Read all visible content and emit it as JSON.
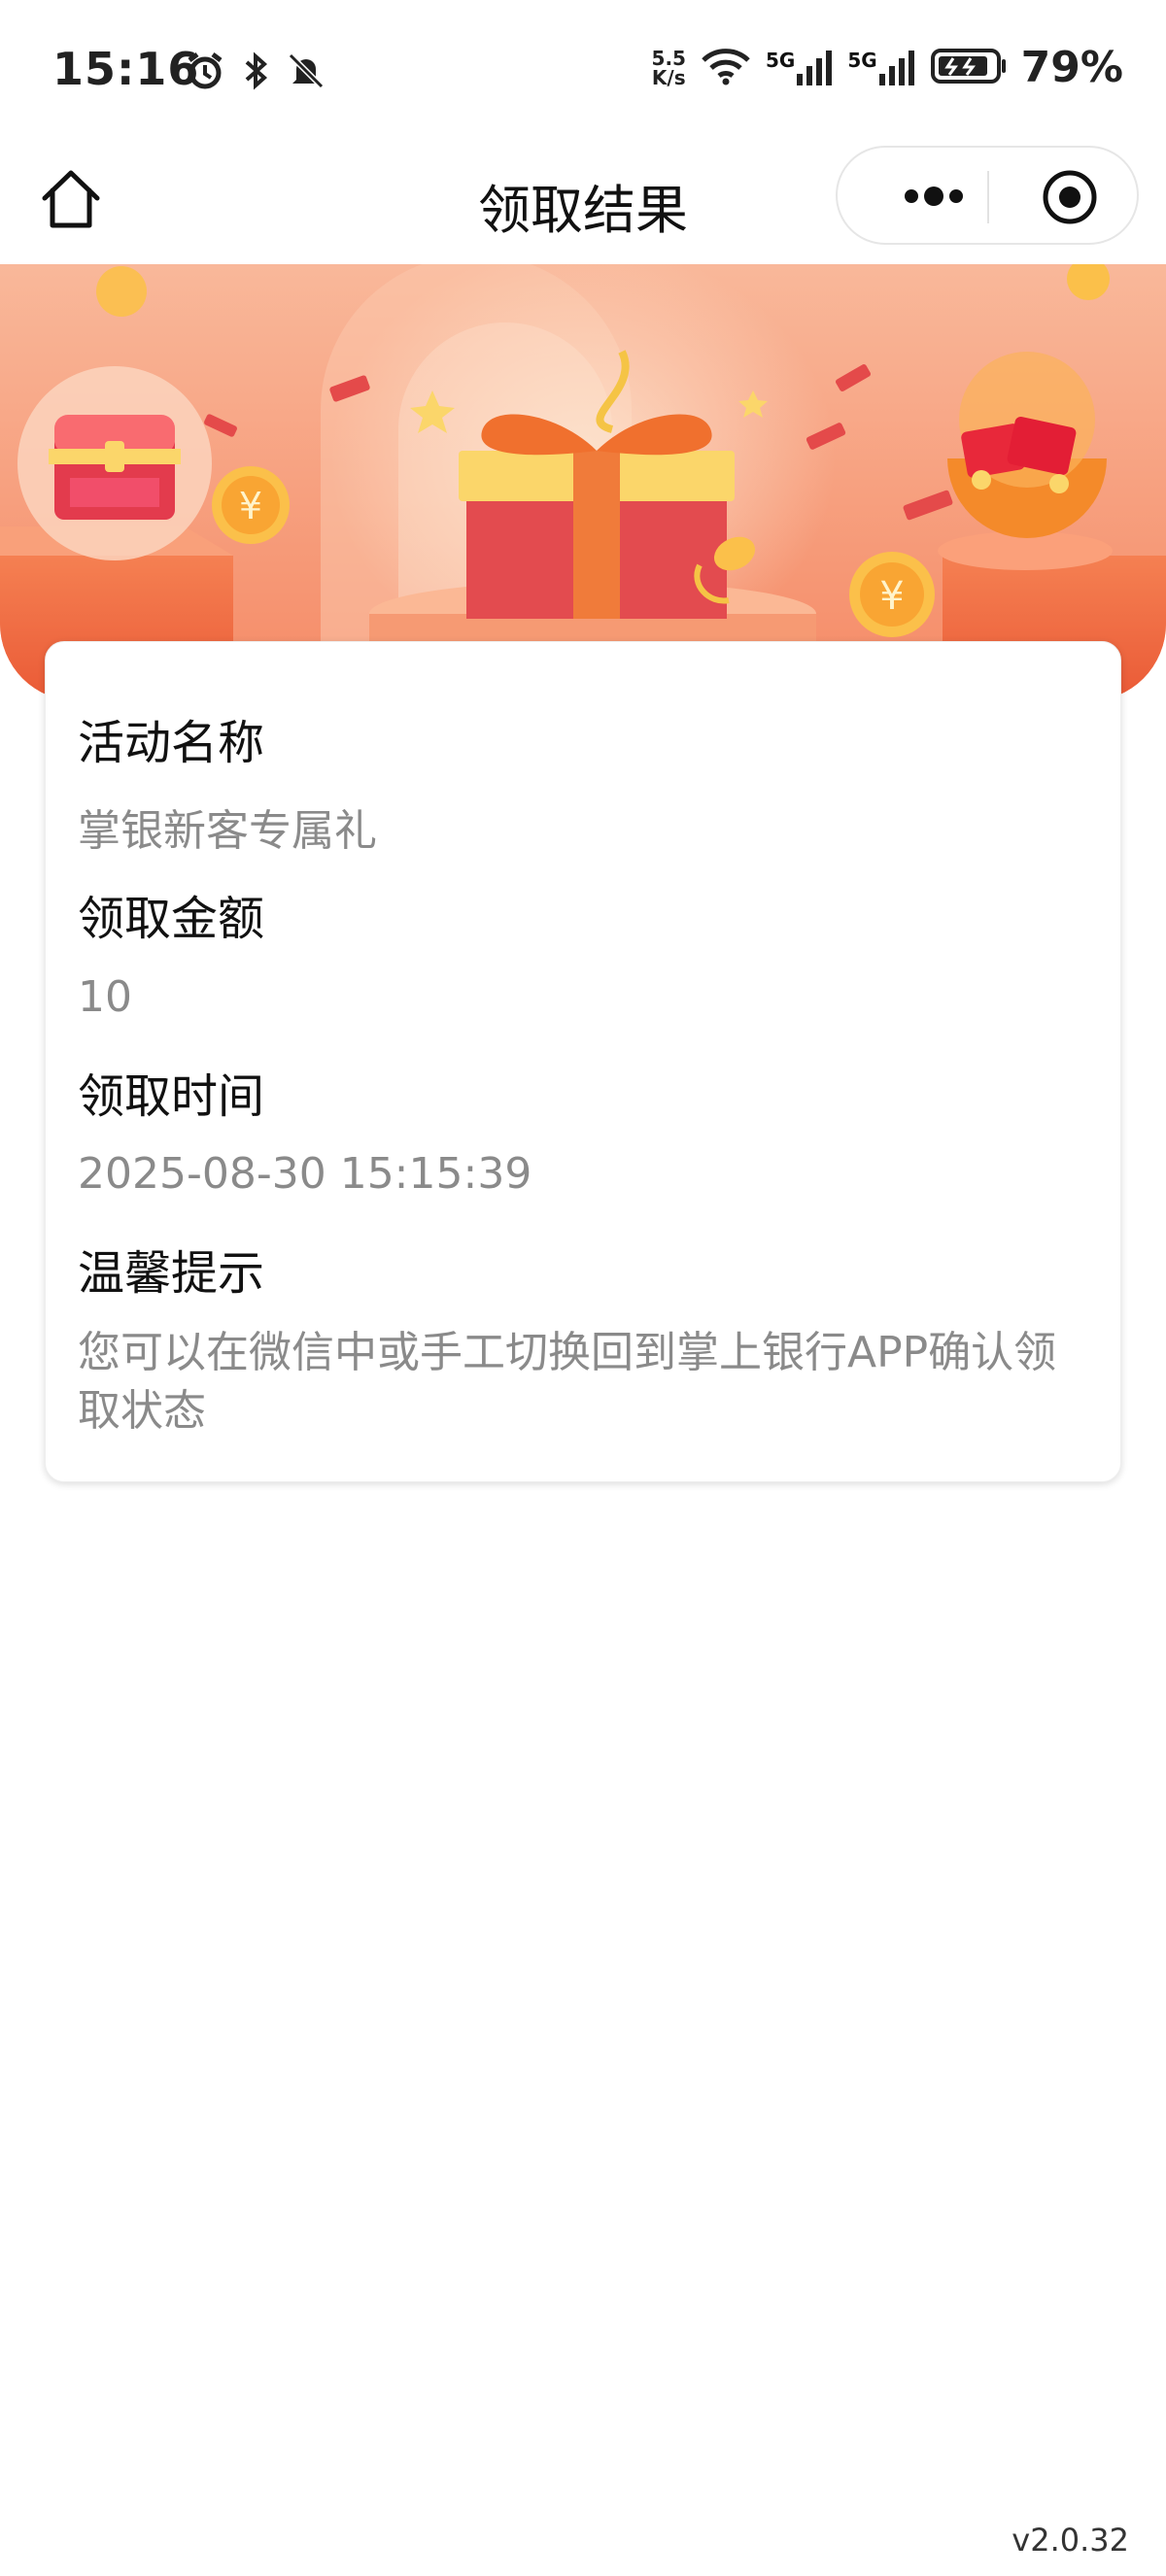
{
  "status_bar": {
    "time": "15:16",
    "net_speed_value": "5.5",
    "net_speed_unit": "K/s",
    "signal_1": "5G",
    "signal_2": "5G",
    "battery_percent": "79%"
  },
  "nav": {
    "title": "领取结果"
  },
  "card": {
    "activity_label": "活动名称",
    "activity_value": "掌银新客专属礼",
    "amount_label": "领取金额",
    "amount_value": "10",
    "time_label": "领取时间",
    "time_value": "2025-08-30 15:15:39",
    "tip_label": "温馨提示",
    "tip_value": "您可以在微信中或手工切换回到掌上银行APP确认领取状态"
  },
  "footer": {
    "version": "v2.0.32"
  },
  "colors": {
    "banner_bg": "#f7a07c",
    "banner_deep": "#f06a48",
    "gift_red": "#e34b4f",
    "gift_yellow": "#fbd66a",
    "value_gray": "#8a8a8a"
  },
  "icons": [
    "alarm-icon",
    "bluetooth-icon",
    "mute-icon",
    "wifi-icon",
    "signal-icon",
    "battery-icon",
    "home-icon",
    "more-icon",
    "target-icon"
  ]
}
